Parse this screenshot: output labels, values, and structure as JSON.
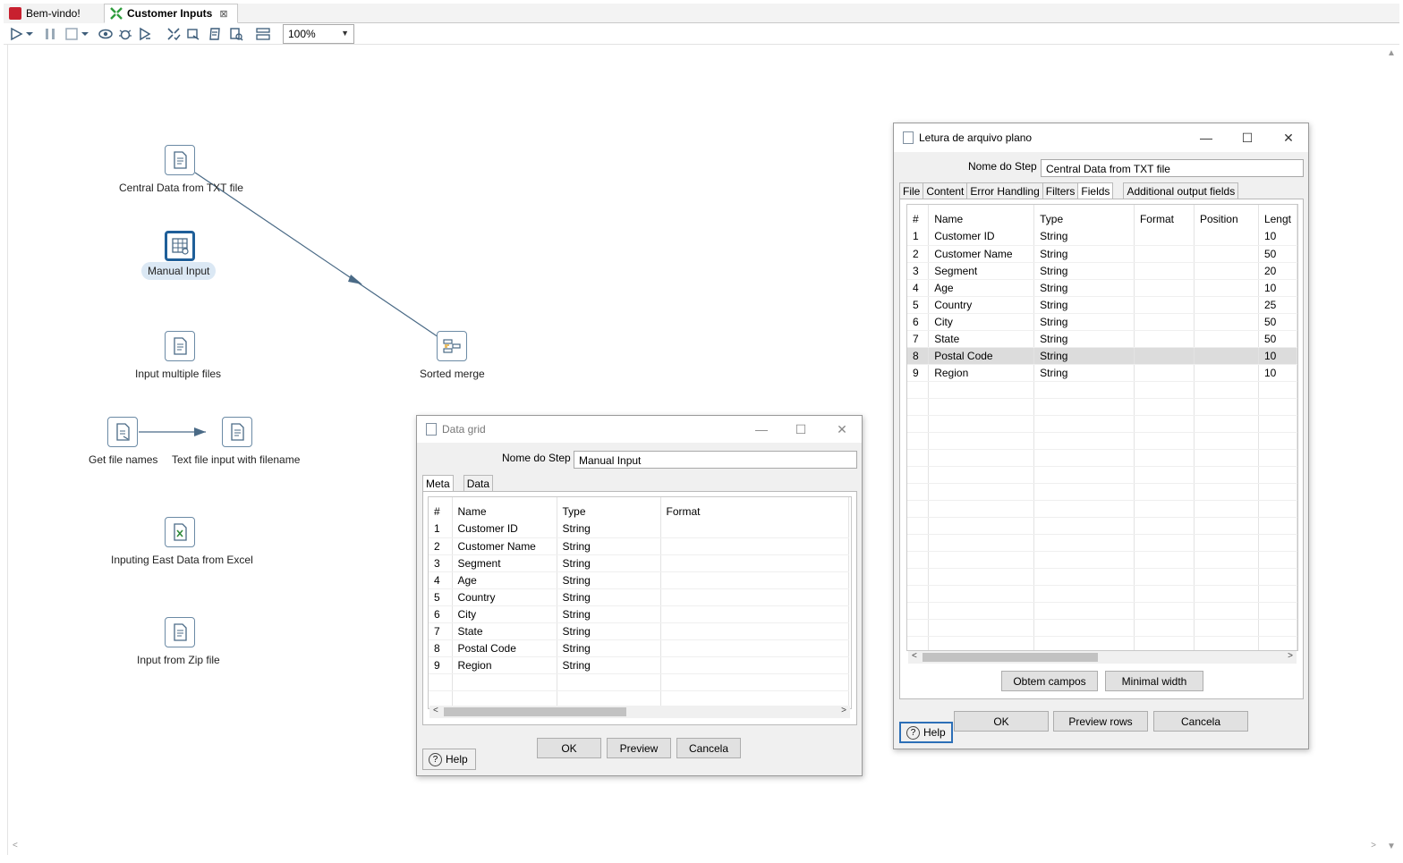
{
  "tabs": [
    {
      "label": "Bem-vindo!",
      "icon": "spoon-logo-icon"
    },
    {
      "label": "Customer Inputs",
      "icon": "transformation-icon",
      "close": "⊠"
    }
  ],
  "toolbar": {
    "zoom": "100%"
  },
  "steps": {
    "central_data": "Central Data from TXT file",
    "manual_input": "Manual Input",
    "input_multiple": "Input multiple files",
    "sorted_merge": "Sorted merge",
    "get_file_names": "Get file names",
    "text_file_input": "Text file input with filename",
    "excel": "Inputing East Data from Excel",
    "zip": "Input from Zip file"
  },
  "data_grid": {
    "title": "Data grid",
    "step_label": "Nome do Step",
    "step_value": "Manual Input",
    "tabs": [
      "Meta",
      "Data"
    ],
    "columns": [
      "#",
      "Name",
      "Type",
      "Format"
    ],
    "rows": [
      [
        "1",
        "Customer ID",
        "String"
      ],
      [
        "2",
        "Customer Name",
        "String"
      ],
      [
        "3",
        "Segment",
        "String"
      ],
      [
        "4",
        "Age",
        "String"
      ],
      [
        "5",
        "Country",
        "String"
      ],
      [
        "6",
        "City",
        "String"
      ],
      [
        "7",
        "State",
        "String"
      ],
      [
        "8",
        "Postal Code",
        "String"
      ],
      [
        "9",
        "Region",
        "String"
      ]
    ],
    "buttons": {
      "ok": "OK",
      "preview": "Preview",
      "cancel": "Cancela",
      "help": "Help"
    }
  },
  "text_file": {
    "title": "Letura de arquivo plano",
    "step_label": "Nome do Step",
    "step_value": "Central Data from TXT file",
    "tabs": [
      "File",
      "Content",
      "Error Handling",
      "Filters",
      "Fields",
      "Additional output fields"
    ],
    "columns": [
      "#",
      "Name",
      "Type",
      "Format",
      "Position",
      "Lengt"
    ],
    "rows": [
      [
        "1",
        "Customer ID",
        "String",
        "10"
      ],
      [
        "2",
        "Customer Name",
        "String",
        "50"
      ],
      [
        "3",
        "Segment",
        "String",
        "20"
      ],
      [
        "4",
        "Age",
        "String",
        "10"
      ],
      [
        "5",
        "Country",
        "String",
        "25"
      ],
      [
        "6",
        "City",
        "String",
        "50"
      ],
      [
        "7",
        "State",
        "String",
        "50"
      ],
      [
        "8",
        "Postal Code",
        "String",
        "10"
      ],
      [
        "9",
        "Region",
        "String",
        "10"
      ]
    ],
    "selected_row": 8,
    "buttons": {
      "get_fields": "Obtem campos",
      "min_width": "Minimal width",
      "ok": "OK",
      "preview_rows": "Preview rows",
      "cancel": "Cancela",
      "help": "Help"
    }
  }
}
